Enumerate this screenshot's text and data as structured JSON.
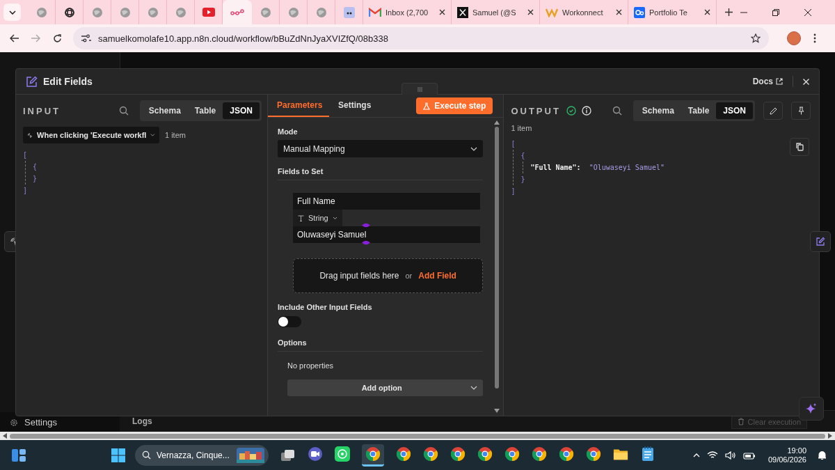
{
  "browser": {
    "tabs": [
      {
        "kind": "globe",
        "selected": false
      },
      {
        "kind": "grid",
        "selected": false
      },
      {
        "kind": "globe",
        "selected": false
      },
      {
        "kind": "globe",
        "selected": false
      },
      {
        "kind": "globe",
        "selected": false
      },
      {
        "kind": "globe",
        "selected": false
      },
      {
        "kind": "youtube",
        "selected": false
      },
      {
        "kind": "n8n",
        "selected": true
      },
      {
        "kind": "globe",
        "selected": false
      },
      {
        "kind": "globe",
        "selected": false
      },
      {
        "kind": "globe",
        "selected": false
      },
      {
        "kind": "mletter",
        "selected": false
      },
      {
        "kind": "gmail",
        "title": "Inbox (2,700",
        "selected": false
      },
      {
        "kind": "x",
        "title": "Samuel (@S",
        "selected": false
      },
      {
        "kind": "wlogo",
        "title": "Workonnect",
        "selected": false
      },
      {
        "kind": "behance",
        "title": "Portfolio Te",
        "selected": false
      }
    ],
    "url": "samuelkomolafe10.app.n8n.cloud/workflow/bBuZdNnJyaXVIZfQ/08b338"
  },
  "background": {
    "settings": "Settings",
    "logs": "Logs",
    "clear": "Clear execution"
  },
  "modal": {
    "title": "Edit Fields",
    "docs": "Docs",
    "input": {
      "heading": "INPUT",
      "views": [
        {
          "label": "Schema",
          "selected": false
        },
        {
          "label": "Table",
          "selected": false
        },
        {
          "label": "JSON",
          "selected": true
        }
      ],
      "trigger": "When clicking 'Execute workfl",
      "count": "1 item",
      "json": {
        "open": "[",
        "close": "]",
        "items": [
          {
            "open": "{",
            "close": "}"
          }
        ]
      }
    },
    "parameters": {
      "tabs": [
        {
          "label": "Parameters",
          "selected": true
        },
        {
          "label": "Settings",
          "selected": false
        }
      ],
      "execute": "Execute step",
      "mode_label": "Mode",
      "mode_value": "Manual Mapping",
      "fields_label": "Fields to Set",
      "field": {
        "name": "Full Name",
        "type": "String",
        "value": "Oluwaseyi Samuel"
      },
      "drop_text": "Drag input fields here",
      "or": "or",
      "add_field": "Add Field",
      "include_label": "Include Other Input Fields",
      "include_on": false,
      "options_label": "Options",
      "no_properties": "No properties",
      "add_option": "Add option"
    },
    "output": {
      "heading": "OUTPUT",
      "views": [
        {
          "label": "Schema",
          "selected": false
        },
        {
          "label": "Table",
          "selected": false
        },
        {
          "label": "JSON",
          "selected": true
        }
      ],
      "count": "1 item",
      "json": {
        "open": "[",
        "close": "]",
        "items": [
          {
            "open": "{",
            "close": "}",
            "pairs": [
              {
                "key": "\"Full Name\":",
                "value": "\"Oluwaseyi Samuel\""
              }
            ]
          }
        ]
      }
    }
  },
  "taskbar": {
    "search": "Vernazza, Cinque...",
    "apps": [
      {
        "kind": "meet",
        "selected": false
      },
      {
        "kind": "whatsapp",
        "selected": false
      },
      {
        "kind": "chrome",
        "selected": true
      },
      {
        "kind": "chrome",
        "selected": false
      },
      {
        "kind": "chrome",
        "selected": false
      },
      {
        "kind": "chrome",
        "selected": false
      },
      {
        "kind": "chrome",
        "selected": false
      },
      {
        "kind": "chrome",
        "selected": false
      },
      {
        "kind": "chrome",
        "selected": false
      },
      {
        "kind": "chrome",
        "selected": false
      },
      {
        "kind": "chrome",
        "selected": false
      },
      {
        "kind": "folder",
        "selected": false
      },
      {
        "kind": "notepad",
        "selected": false
      }
    ],
    "time": "19:00",
    "date": "09/06/2026"
  }
}
